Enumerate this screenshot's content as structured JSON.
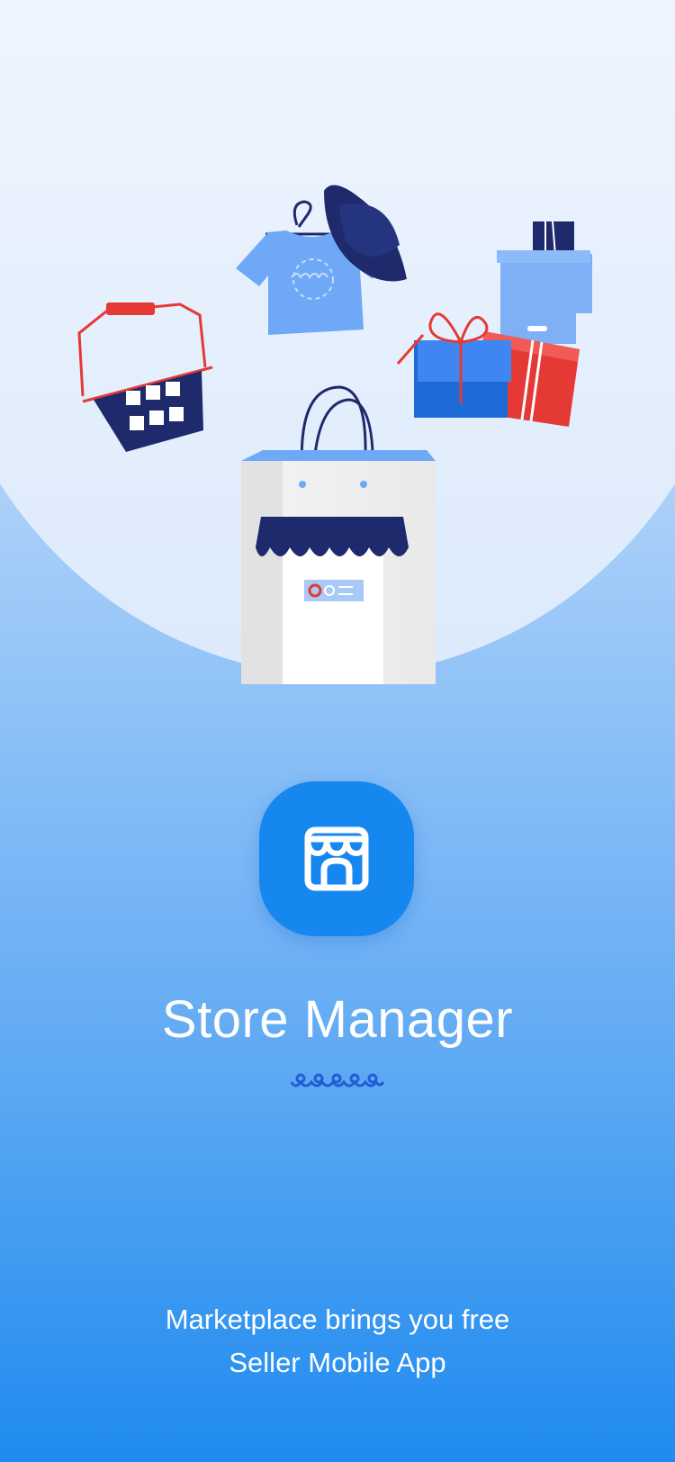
{
  "app": {
    "title": "Store Manager",
    "tagline_line1": "Marketplace brings you free",
    "tagline_line2": "Seller Mobile App"
  },
  "icons": {
    "app_icon": "storefront-icon",
    "decoration": "wave-ornament-icon",
    "illustration": [
      "basket-icon",
      "tshirt-icon",
      "hat-icon",
      "gift-boxes-icon",
      "shopping-bag-store-icon"
    ]
  },
  "colors": {
    "accent": "#1687ef",
    "navy": "#1e2a6b",
    "red": "#e53935",
    "light_blue": "#6ea8f7",
    "white": "#ffffff"
  }
}
